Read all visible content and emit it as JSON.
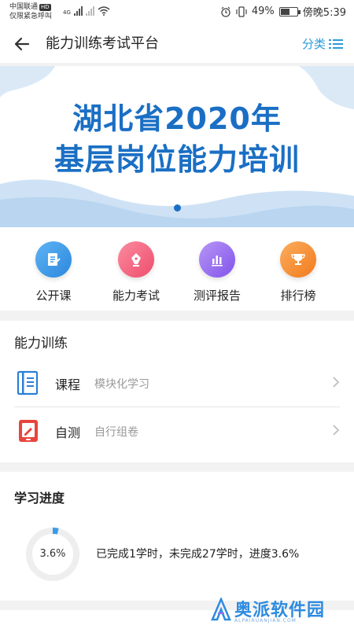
{
  "status_bar": {
    "carrier": "中国联通",
    "carrier_badge": "HD",
    "emergency": "仅限紧急呼叫",
    "network": "4G",
    "battery": "49%",
    "time": "傍晚5:39"
  },
  "app_bar": {
    "title": "能力训练考试平台",
    "category_label": "分类"
  },
  "banner": {
    "line1": "湖北省2020年",
    "line2": "基层岗位能力培训"
  },
  "quick_menu": [
    {
      "label": "公开课",
      "icon": "document-edit-icon",
      "color": "#3b9be8"
    },
    {
      "label": "能力考试",
      "icon": "pen-icon",
      "color": "#f2607a"
    },
    {
      "label": "测评报告",
      "icon": "bar-chart-icon",
      "color": "#9b6cf0"
    },
    {
      "label": "排行榜",
      "icon": "trophy-icon",
      "color": "#f5892e"
    }
  ],
  "training": {
    "title": "能力训练",
    "rows": [
      {
        "name": "课程",
        "sub": "模块化学习",
        "icon": "course-book-icon"
      },
      {
        "name": "自测",
        "sub": "自行组卷",
        "icon": "self-test-icon"
      }
    ]
  },
  "progress": {
    "title": "学习进度",
    "percent_label": "3.6%",
    "percent": 3.6,
    "description": "已完成1学时，未完成27学时，进度3.6%"
  },
  "watermark": {
    "text": "奥派软件园",
    "sub": "ALPAIRUANJIAN.COM"
  },
  "colors": {
    "accent": "#2d9bd8",
    "banner_text": "#1a6fc4"
  }
}
